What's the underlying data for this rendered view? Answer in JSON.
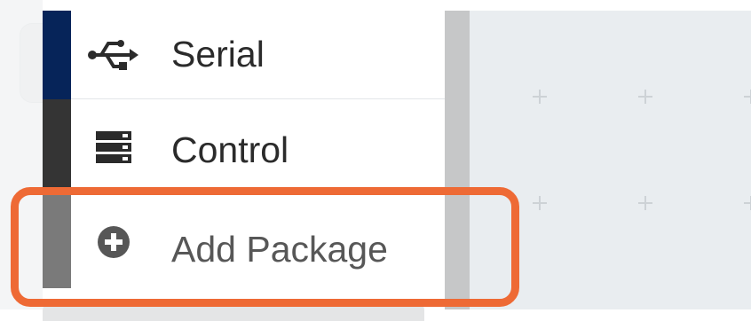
{
  "sidebar": {
    "items": [
      {
        "label": "Serial",
        "icon": "usb-icon",
        "color": "#062459"
      },
      {
        "label": "Control",
        "icon": "server-rack-icon",
        "color": "#343434"
      },
      {
        "label": "Add Package",
        "icon": "plus-circle-icon",
        "color": "#7a7a7a"
      }
    ]
  },
  "highlight": {
    "color": "#ee6a35",
    "target": "Add Package"
  },
  "workspace": {
    "background": "#e9edf0"
  }
}
